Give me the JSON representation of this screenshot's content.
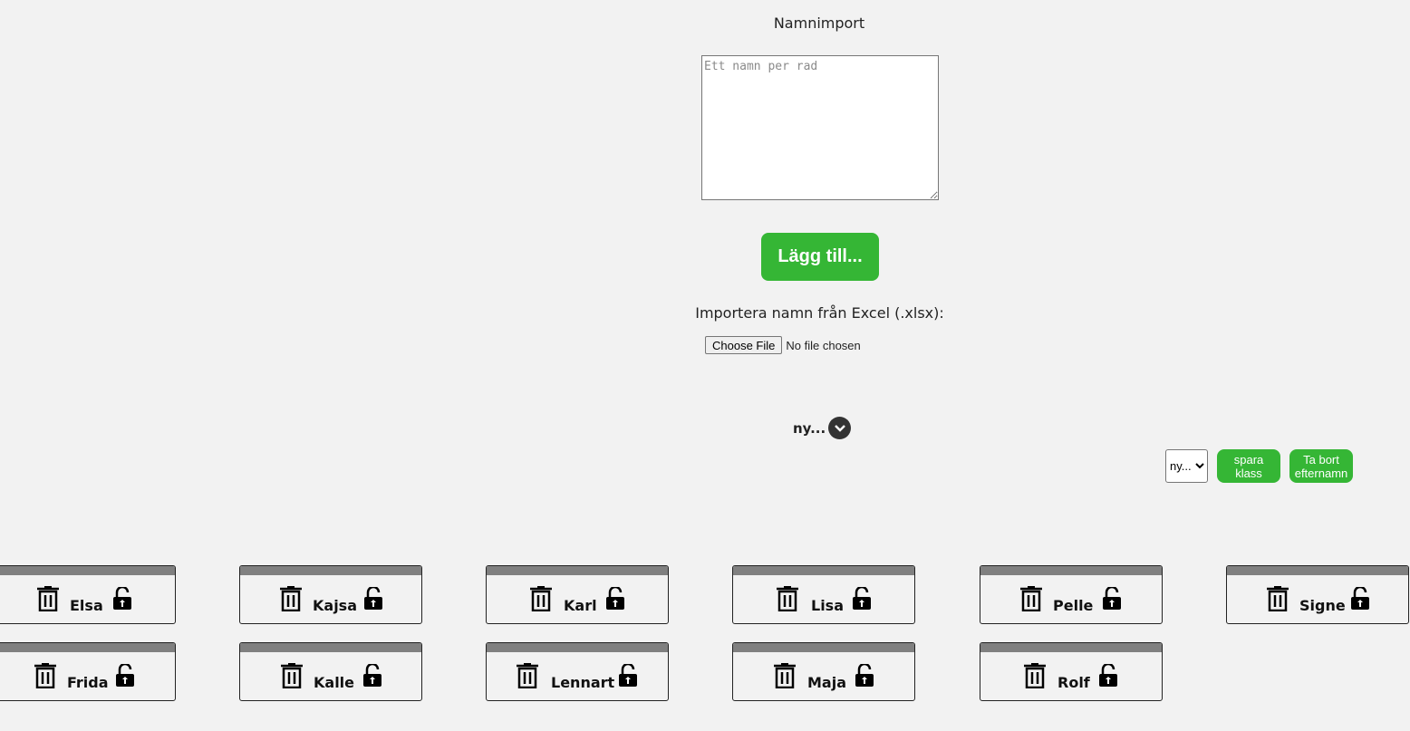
{
  "header": {
    "title": "Namnimport"
  },
  "import": {
    "placeholder": "Ett namn per rad",
    "add_button": "Lägg till...",
    "excel_label": "Importera namn från Excel (.xlsx):",
    "file_button": "Choose File",
    "file_status": "No file chosen"
  },
  "class_toggle": {
    "label": "ny..."
  },
  "controls": {
    "select_value": "ny...",
    "save_button": "spara klass",
    "remove_button": "Ta bort efternamn"
  },
  "students": [
    {
      "name": "Elsa"
    },
    {
      "name": "Kajsa"
    },
    {
      "name": "Karl"
    },
    {
      "name": "Lisa"
    },
    {
      "name": "Pelle"
    },
    {
      "name": "Signe"
    },
    {
      "name": "Frida"
    },
    {
      "name": "Kalle"
    },
    {
      "name": "Lennart"
    },
    {
      "name": "Maja"
    },
    {
      "name": "Rolf"
    }
  ],
  "icons": {
    "delete": "trash-icon",
    "lock": "unlock-icon",
    "toggle": "chevron-down-icon"
  },
  "colors": {
    "accent": "#35b635",
    "card_bar": "#808080",
    "background": "#f2f2f2"
  }
}
